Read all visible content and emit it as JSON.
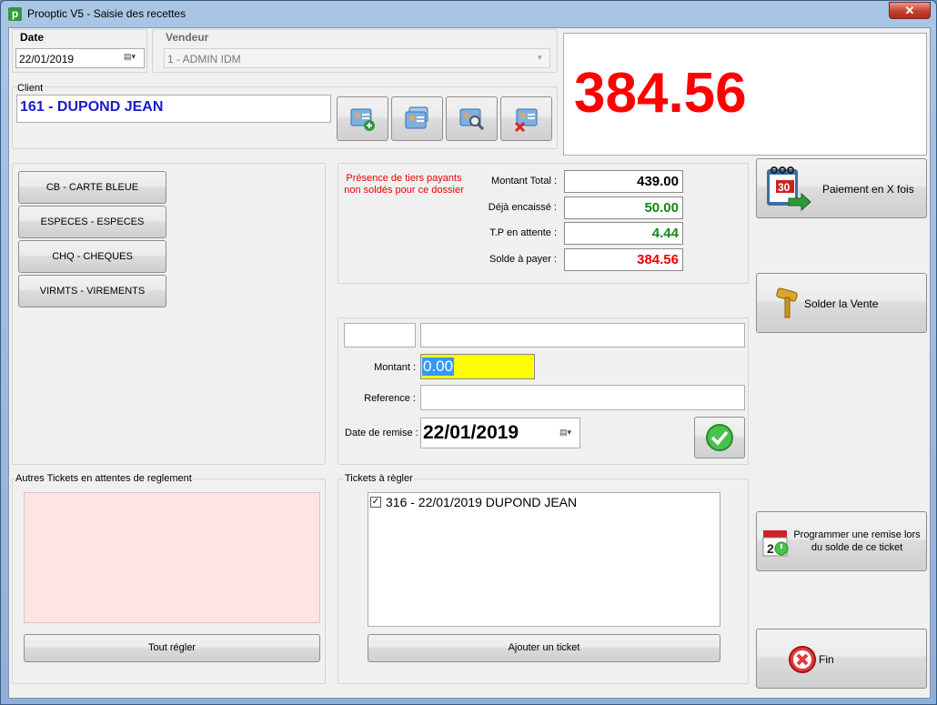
{
  "window": {
    "title": "Prooptic V5 - Saisie des recettes",
    "close_glyph": "✕"
  },
  "date": {
    "label": "Date",
    "value": "22/01/2019"
  },
  "vendeur": {
    "label": "Vendeur",
    "value": "1 - ADMIN IDM"
  },
  "client": {
    "label": "Client",
    "value": "161 - DUPOND JEAN"
  },
  "client_buttons": [
    {
      "icon": "client-add-icon"
    },
    {
      "icon": "client-cards-icon"
    },
    {
      "icon": "client-search-icon"
    },
    {
      "icon": "client-delete-icon"
    }
  ],
  "big_total": "384.56",
  "payment_methods": [
    "CB - CARTE BLEUE",
    "ESPECES - ESPECES",
    "CHQ - CHEQUES",
    "VIRMTS - VIREMENTS"
  ],
  "warning": "Présence de tiers payants non soldés pour ce dossier",
  "summary": {
    "total_label": "Montant Total :",
    "total_value": "439.00",
    "deja_label": "Déjà encaissé :",
    "deja_value": "50.00",
    "tp_label": "T.P en attente :",
    "tp_value": "4.44",
    "solde_label": "Solde à payer :",
    "solde_value": "384.56"
  },
  "entry": {
    "code_value": "",
    "name_value": "",
    "montant_label": "Montant :",
    "montant_value": "0.00",
    "reference_label": "Reference :",
    "reference_value": "",
    "date_remise_label": "Date de remise :",
    "date_remise_value": "22/01/2019"
  },
  "right_buttons": {
    "paiement": "Paiement en X fois",
    "solder": "Solder la Vente",
    "programmer": "Programmer une remise lors du solde de ce ticket",
    "fin": "Fin"
  },
  "autres_tickets": {
    "label": "Autres Tickets en attentes de reglement",
    "button": "Tout régler"
  },
  "tickets": {
    "label": "Tickets à règler",
    "items": [
      {
        "checked": true,
        "text": "316 - 22/01/2019 DUPOND JEAN"
      }
    ],
    "button": "Ajouter un ticket"
  },
  "colors": {
    "red": "#ff0000",
    "green": "#008000",
    "blue": "#0000cc",
    "yellow": "#ffff00"
  }
}
